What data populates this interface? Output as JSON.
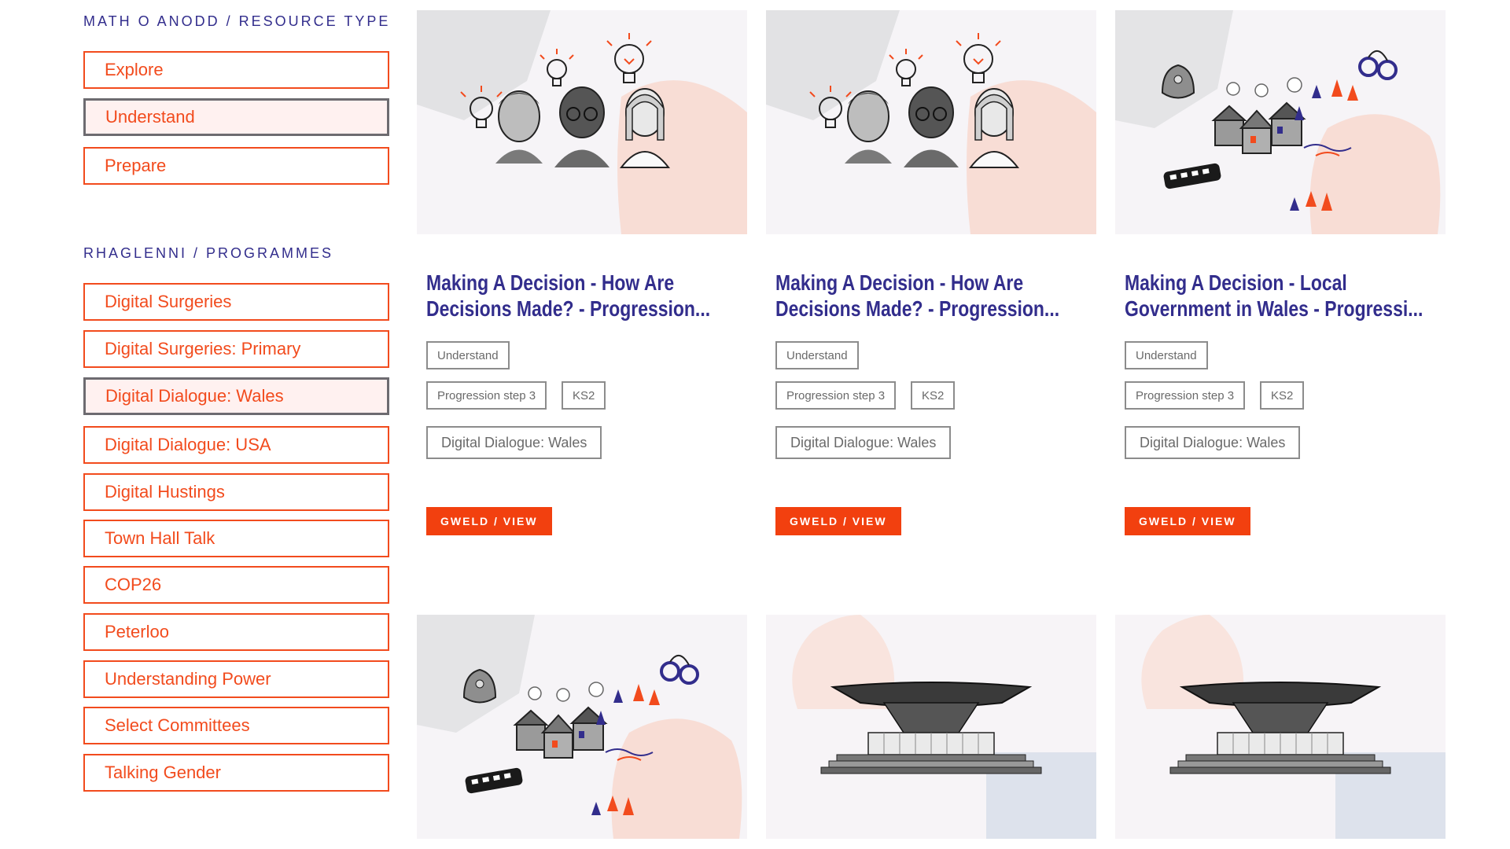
{
  "sidebar": {
    "resource_type_heading": "MATH O ANODD / RESOURCE TYPE",
    "resource_types": [
      {
        "label": "Explore",
        "active": false
      },
      {
        "label": "Understand",
        "active": true
      },
      {
        "label": "Prepare",
        "active": false
      }
    ],
    "programmes_heading": "RHAGLENNI / PROGRAMMES",
    "programmes": [
      {
        "label": "Digital Surgeries",
        "active": false
      },
      {
        "label": "Digital Surgeries: Primary",
        "active": false
      },
      {
        "label": "Digital Dialogue: Wales",
        "active": true
      },
      {
        "label": "Digital Dialogue: USA",
        "active": false
      },
      {
        "label": "Digital Hustings",
        "active": false
      },
      {
        "label": "Town Hall Talk",
        "active": false
      },
      {
        "label": "COP26",
        "active": false
      },
      {
        "label": "Peterloo",
        "active": false
      },
      {
        "label": "Understanding Power",
        "active": false
      },
      {
        "label": "Select Committees",
        "active": false
      },
      {
        "label": "Talking Gender",
        "active": false
      }
    ]
  },
  "cards": [
    {
      "title": "Making A Decision - How Are Decisions Made? - Progression...",
      "image": "students-lightbulbs-illustration",
      "type_tag": "Understand",
      "level_tags": [
        "Progression step 3",
        "KS2"
      ],
      "programme_tag": "Digital Dialogue: Wales",
      "view_label": "GWELD / VIEW"
    },
    {
      "title": "Making A Decision - How Are Decisions Made? - Progression...",
      "image": "students-lightbulbs-illustration",
      "type_tag": "Understand",
      "level_tags": [
        "Progression step 3",
        "KS2"
      ],
      "programme_tag": "Digital Dialogue: Wales",
      "view_label": "GWELD / VIEW"
    },
    {
      "title": "Making A Decision - Local Government in Wales - Progressi...",
      "image": "local-government-town-illustration",
      "type_tag": "Understand",
      "level_tags": [
        "Progression step 3",
        "KS2"
      ],
      "programme_tag": "Digital Dialogue: Wales",
      "view_label": "GWELD / VIEW"
    },
    {
      "image": "local-government-town-illustration"
    },
    {
      "image": "senedd-building-illustration"
    },
    {
      "image": "senedd-building-illustration"
    }
  ],
  "colors": {
    "accent": "#f24b1d",
    "heading": "#322d8c",
    "active_fill": "#fff1f0",
    "tag_border": "#8c8c8c"
  }
}
